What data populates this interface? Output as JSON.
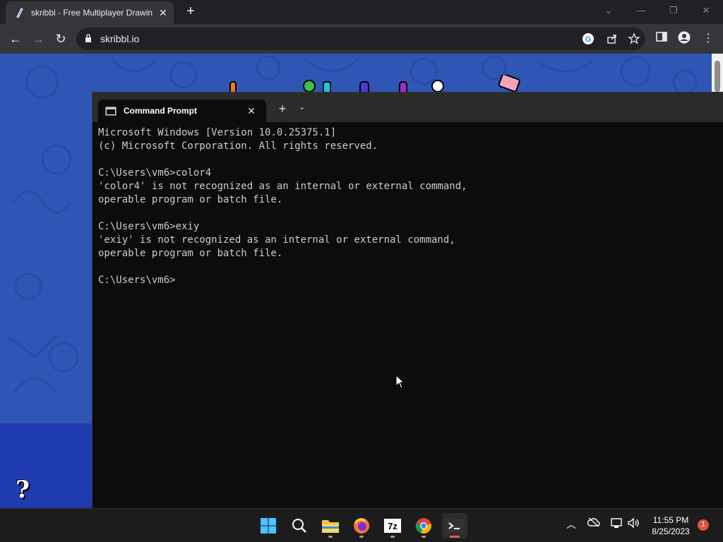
{
  "browser": {
    "tab_title": "skribbl - Free Multiplayer Drawin",
    "tab_close": "✕",
    "new_tab": "+",
    "url": "skribbl.io"
  },
  "terminal": {
    "tab_title": "Command Prompt",
    "tab_close": "✕",
    "new_tab": "+",
    "dropdown": "⌄",
    "lines": [
      "Microsoft Windows [Version 10.0.25375.1]",
      "(c) Microsoft Corporation. All rights reserved.",
      "",
      "C:\\Users\\vm6>color4",
      "'color4' is not recognized as an internal or external command,",
      "operable program or batch file.",
      "",
      "C:\\Users\\vm6>exiy",
      "'exiy' is not recognized as an internal or external command,",
      "operable program or batch file.",
      "",
      "C:\\Users\\vm6>"
    ]
  },
  "page": {
    "help_symbol": "?"
  },
  "taskbar": {
    "apps": [
      {
        "name": "start-button",
        "icon": "windows-icon"
      },
      {
        "name": "search-button",
        "icon": "search-icon"
      },
      {
        "name": "file-explorer-app",
        "icon": "folder-icon"
      },
      {
        "name": "firefox-app",
        "icon": "firefox-icon"
      },
      {
        "name": "7zip-app",
        "icon": "7z-icon",
        "text": "7z"
      },
      {
        "name": "chrome-app",
        "icon": "chrome-icon"
      },
      {
        "name": "terminal-app",
        "icon": "terminal-icon"
      }
    ],
    "time": "11:55 PM",
    "date": "8/25/2023",
    "notification_count": "1"
  }
}
